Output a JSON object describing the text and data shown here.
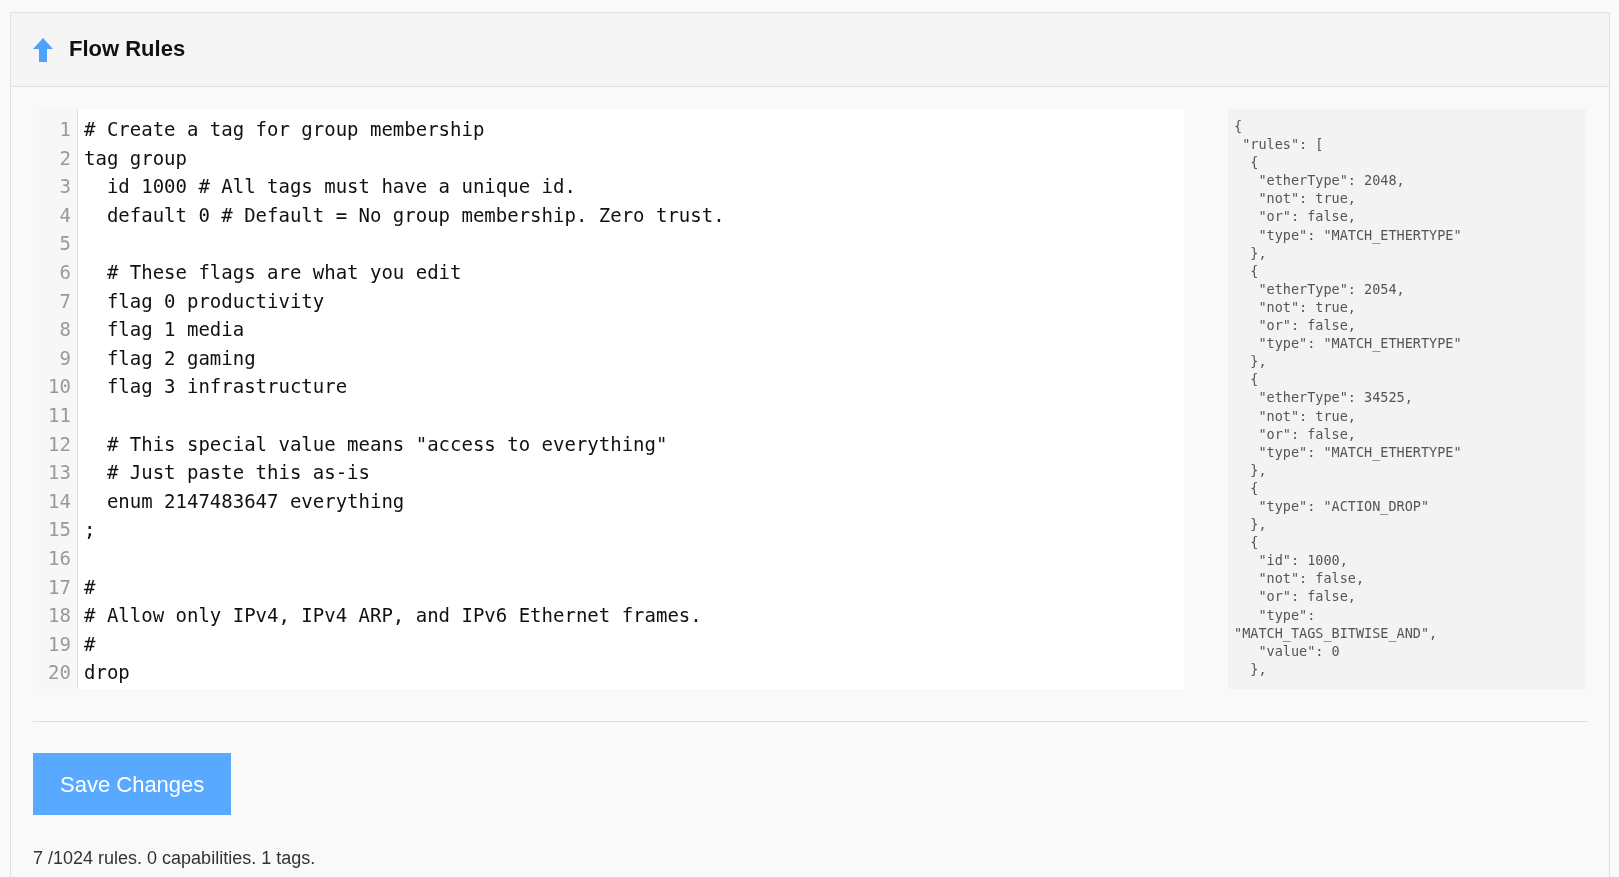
{
  "panel": {
    "title": "Flow Rules"
  },
  "editor": {
    "lines": [
      {
        "number": "1",
        "text": "# Create a tag for group membership"
      },
      {
        "number": "2",
        "text": "tag group"
      },
      {
        "number": "3",
        "text": "  id 1000 # All tags must have a unique id."
      },
      {
        "number": "4",
        "text": "  default 0 # Default = No group membership. Zero trust."
      },
      {
        "number": "5"
      },
      {
        "number": "6",
        "text": "  # These flags are what you edit"
      },
      {
        "number": "7",
        "text": "  flag 0 productivity"
      },
      {
        "number": "8",
        "text": "  flag 1 media"
      },
      {
        "number": "9",
        "text": "  flag 2 gaming"
      },
      {
        "number": "10",
        "text": "  flag 3 infrastructure"
      },
      {
        "number": "11"
      },
      {
        "number": "12",
        "text": "  # This special value means \"access to everything\""
      },
      {
        "number": "13",
        "text": "  # Just paste this as-is"
      },
      {
        "number": "14",
        "text": "  enum 2147483647 everything"
      },
      {
        "number": "15",
        "text": ";"
      },
      {
        "number": "16"
      },
      {
        "number": "17",
        "text": "#"
      },
      {
        "number": "18",
        "text": "# Allow only IPv4, IPv4 ARP, and IPv6 Ethernet frames."
      },
      {
        "number": "19",
        "text": "#"
      },
      {
        "number": "20",
        "text": "drop"
      }
    ]
  },
  "compiled_json": {
    "lines": [
      "{",
      " \"rules\": [",
      "  {",
      "   \"etherType\": 2048,",
      "   \"not\": true,",
      "   \"or\": false,",
      "   \"type\": \"MATCH_ETHERTYPE\"",
      "  },",
      "  {",
      "   \"etherType\": 2054,",
      "   \"not\": true,",
      "   \"or\": false,",
      "   \"type\": \"MATCH_ETHERTYPE\"",
      "  },",
      "  {",
      "   \"etherType\": 34525,",
      "   \"not\": true,",
      "   \"or\": false,",
      "   \"type\": \"MATCH_ETHERTYPE\"",
      "  },",
      "  {",
      "   \"type\": \"ACTION_DROP\"",
      "  },",
      "  {",
      "   \"id\": 1000,",
      "   \"not\": false,",
      "   \"or\": false,",
      "   \"type\":",
      "\"MATCH_TAGS_BITWISE_AND\",",
      "   \"value\": 0",
      "  },"
    ]
  },
  "save_button": "Save Changes",
  "status": "7 /1024 rules. 0 capabilities. 1 tags."
}
